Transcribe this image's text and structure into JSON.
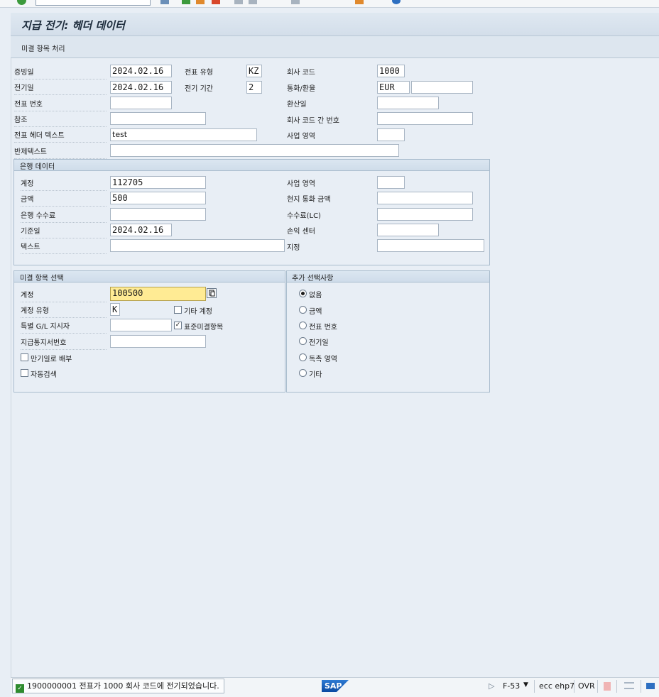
{
  "window": {
    "title": "지급 전기: 헤더 데이터"
  },
  "appbar": {
    "open_items_button": "미결 항목 처리"
  },
  "header": {
    "doc_date_label": "증빙일",
    "doc_date": "2024.02.16",
    "doc_type_label": "전표 유형",
    "doc_type": "KZ",
    "company_code_label": "회사 코드",
    "company_code": "1000",
    "posting_date_label": "전기일",
    "posting_date": "2024.02.16",
    "period_label": "전기 기간",
    "period": "2",
    "currency_label": "통화/환율",
    "currency": "EUR",
    "rate": "",
    "doc_number_label": "전표 번호",
    "doc_number": "",
    "translation_date_label": "환산일",
    "translation_date": "",
    "reference_label": "참조",
    "reference": "",
    "cross_cc_label": "회사 코드 간 번호",
    "cross_cc": "",
    "header_text_label": "전표 헤더 텍스트",
    "header_text": "test",
    "business_area_label": "사업 영역",
    "business_area": "",
    "clearing_text_label": "반제텍스트",
    "clearing_text": ""
  },
  "bank": {
    "title": "은행 데이터",
    "account_label": "계정",
    "account": "112705",
    "business_area_label": "사업 영역",
    "business_area": "",
    "amount_label": "금액",
    "amount": "500",
    "lc_amount_label": "현지 통화 금액",
    "lc_amount": "",
    "bank_charges_label": "은행 수수료",
    "bank_charges": "",
    "lc_charges_label": "수수료(LC)",
    "lc_charges": "",
    "value_date_label": "기준일",
    "value_date": "2024.02.16",
    "profit_center_label": "손익 센터",
    "profit_center": "",
    "text_label": "텍스트",
    "text": "",
    "assignment_label": "지정",
    "assignment": ""
  },
  "open_items": {
    "title": "미결 항목 선택",
    "account_label": "계정",
    "account": "100500",
    "account_type_label": "계정 유형",
    "account_type": "K",
    "other_accounts_label": "기타 계정",
    "special_gl_label": "특별 G/L 지시자",
    "special_gl": "",
    "standard_oi_label": "표준미결항목",
    "payment_advice_label": "지급통지서번호",
    "payment_advice": "",
    "distribute_label": "만기일로 배부",
    "auto_search_label": "자동검색"
  },
  "additional": {
    "title": "추가 선택사항",
    "options": [
      "없음",
      "금액",
      "전표 번호",
      "전기일",
      "독촉 영역",
      "기타"
    ]
  },
  "status": {
    "message": "1900000001 전표가 1000 회사 코드에 전기되었습니다.",
    "transaction": "F-53",
    "system": "ecc ehp7",
    "mode": "OVR"
  }
}
